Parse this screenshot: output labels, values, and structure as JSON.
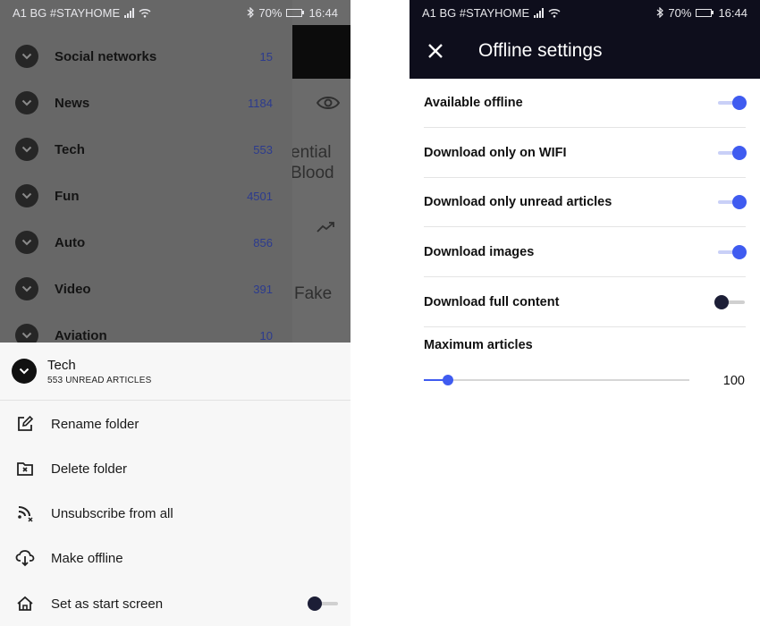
{
  "status_bar": {
    "carrier": "A1 BG #STAYHOME",
    "battery": "70%",
    "time": "16:44",
    "battery_level": 0.7
  },
  "left": {
    "background": {
      "texts": [
        "ential",
        "Blood",
        "Fake"
      ]
    },
    "folders": [
      {
        "name": "Social networks",
        "count": "15"
      },
      {
        "name": "News",
        "count": "1184"
      },
      {
        "name": "Tech",
        "count": "553"
      },
      {
        "name": "Fun",
        "count": "4501"
      },
      {
        "name": "Auto",
        "count": "856"
      },
      {
        "name": "Video",
        "count": "391"
      },
      {
        "name": "Aviation",
        "count": "10"
      }
    ],
    "sheet": {
      "title": "Tech",
      "subtitle": "553 UNREAD ARTICLES",
      "actions": [
        {
          "label": "Rename folder",
          "icon": "edit-icon"
        },
        {
          "label": "Delete folder",
          "icon": "delete-folder-icon"
        },
        {
          "label": "Unsubscribe from all",
          "icon": "rss-remove-icon"
        },
        {
          "label": "Make offline",
          "icon": "cloud-download-icon"
        },
        {
          "label": "Set as start screen",
          "icon": "home-icon"
        }
      ],
      "start_screen_on": false
    }
  },
  "right": {
    "title": "Offline settings",
    "settings": [
      {
        "label": "Available offline",
        "on": true
      },
      {
        "label": "Download only on WIFI",
        "on": true
      },
      {
        "label": "Download only unread articles",
        "on": true
      },
      {
        "label": "Download images",
        "on": true
      },
      {
        "label": "Download full content",
        "on": false
      }
    ],
    "max_articles_label": "Maximum articles",
    "max_articles_value": "100",
    "max_articles_fraction": 0.09
  },
  "colors": {
    "accent": "#3f5bf0",
    "top_bar": "#0e0e1c",
    "count_blue": "#2c3b8e"
  }
}
